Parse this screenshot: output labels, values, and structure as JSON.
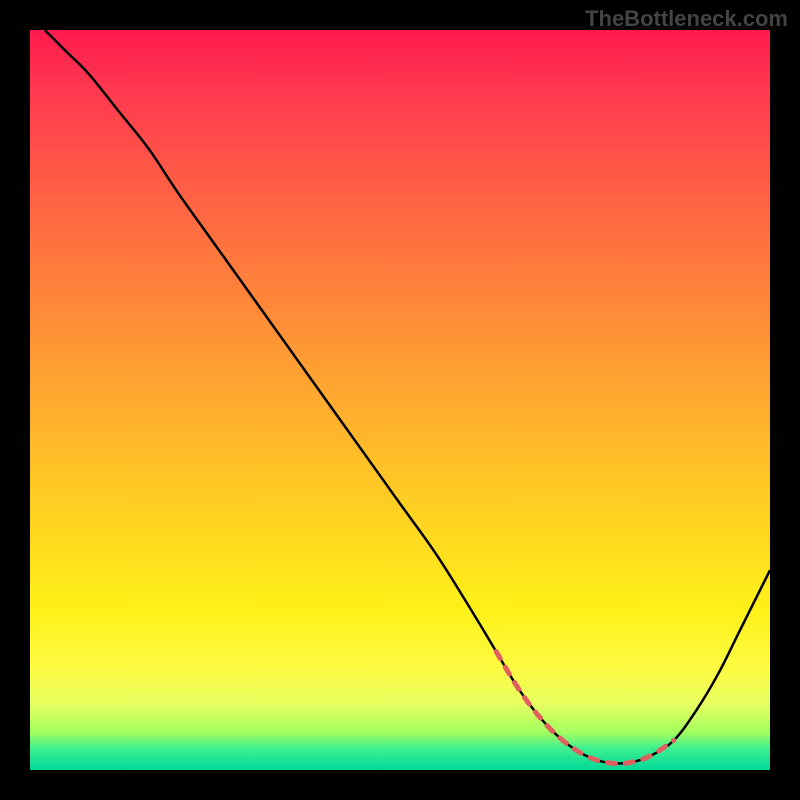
{
  "watermark": "TheBottleneck.com",
  "chart_data": {
    "type": "line",
    "title": "",
    "xlabel": "",
    "ylabel": "",
    "xlim": [
      0,
      100
    ],
    "ylim": [
      0,
      100
    ],
    "series": [
      {
        "name": "bottleneck-curve",
        "x": [
          2,
          5,
          8,
          12,
          16,
          20,
          25,
          30,
          35,
          40,
          45,
          50,
          55,
          60,
          63,
          66,
          69,
          72,
          75,
          78,
          81,
          84,
          87,
          90,
          93,
          96,
          100
        ],
        "y": [
          100,
          97,
          94,
          89,
          84,
          78,
          71,
          64,
          57,
          50,
          43,
          36,
          29,
          21,
          16,
          11,
          7,
          4,
          2,
          1,
          1,
          2,
          4,
          8,
          13,
          19,
          27
        ]
      },
      {
        "name": "optimal-mark",
        "x": [
          63,
          66,
          69,
          72,
          75,
          78,
          81,
          84,
          87
        ],
        "y": [
          16,
          11,
          7,
          4,
          2,
          1,
          1,
          2,
          4
        ]
      }
    ],
    "background_gradient": {
      "stops": [
        {
          "pos": 0,
          "color": "#ff1a4d"
        },
        {
          "pos": 50,
          "color": "#ffbf28"
        },
        {
          "pos": 85,
          "color": "#fffb40"
        },
        {
          "pos": 100,
          "color": "#00d898"
        }
      ]
    }
  }
}
